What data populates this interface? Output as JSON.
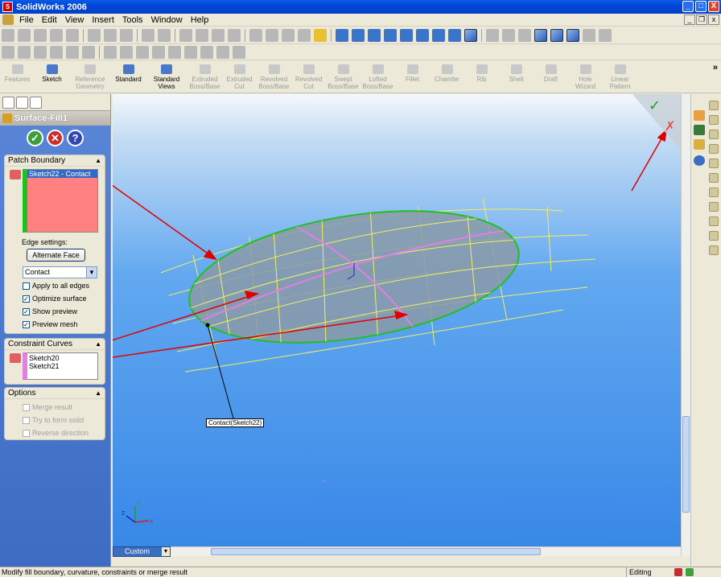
{
  "window": {
    "title": "SolidWorks 2006",
    "min": "_",
    "max": "□",
    "close": "X"
  },
  "menu": [
    "File",
    "Edit",
    "View",
    "Insert",
    "Tools",
    "Window",
    "Help"
  ],
  "command_manager": {
    "items": [
      {
        "label": "Features",
        "active": false
      },
      {
        "label": "Sketch",
        "active": true
      },
      {
        "label": "Reference\nGeometry",
        "active": false
      },
      {
        "label": "Standard",
        "active": true
      },
      {
        "label": "Standard\nViews",
        "active": true
      },
      {
        "label": "Extruded\nBoss/Base",
        "active": false
      },
      {
        "label": "Extruded\nCut",
        "active": false
      },
      {
        "label": "Revolved\nBoss/Base",
        "active": false
      },
      {
        "label": "Revolved\nCut",
        "active": false
      },
      {
        "label": "Swept\nBoss/Base",
        "active": false
      },
      {
        "label": "Lofted\nBoss/Base",
        "active": false
      },
      {
        "label": "Fillet",
        "active": false
      },
      {
        "label": "Chamfer",
        "active": false
      },
      {
        "label": "Rib",
        "active": false
      },
      {
        "label": "Shell",
        "active": false
      },
      {
        "label": "Draft",
        "active": false
      },
      {
        "label": "Hole\nWizard",
        "active": false
      },
      {
        "label": "Linear\nPattern",
        "active": false
      }
    ],
    "more": "»"
  },
  "property_manager": {
    "title": "Surface-Fill1",
    "ok": "✓",
    "cancel": "✕",
    "help": "?",
    "patch_boundary": {
      "heading": "Patch Boundary",
      "selected_item": "Sketch22 - Contact",
      "edge_settings_label": "Edge settings:",
      "alternate_face_button": "Alternate Face",
      "condition_value": "Contact",
      "checkboxes": [
        {
          "label": "Apply to all edges",
          "checked": false
        },
        {
          "label": "Optimize surface",
          "checked": true
        },
        {
          "label": "Show preview",
          "checked": true
        },
        {
          "label": "Preview mesh",
          "checked": true
        }
      ]
    },
    "constraint_curves": {
      "heading": "Constraint Curves",
      "items": [
        "Sketch20",
        "Sketch21"
      ]
    },
    "options": {
      "heading": "Options",
      "checkboxes": [
        {
          "label": "Merge result",
          "checked": false
        },
        {
          "label": "Try to form solid",
          "checked": false
        },
        {
          "label": "Reverse direction",
          "checked": false
        }
      ]
    }
  },
  "viewport": {
    "callout": "Contact(Sketch22)",
    "tab_label": "Custom",
    "triad_x": "X",
    "triad_y": "Y",
    "triad_z": "Z"
  },
  "status": {
    "message": "Modify fill boundary, curvature, constraints or merge result",
    "mode": "Editing Part"
  },
  "colors": {
    "boundary_green": "#20c020",
    "constraint_pink": "#e080e0",
    "annotation_arrow": "#e00000",
    "mesh_yellow": "#f0f060"
  }
}
